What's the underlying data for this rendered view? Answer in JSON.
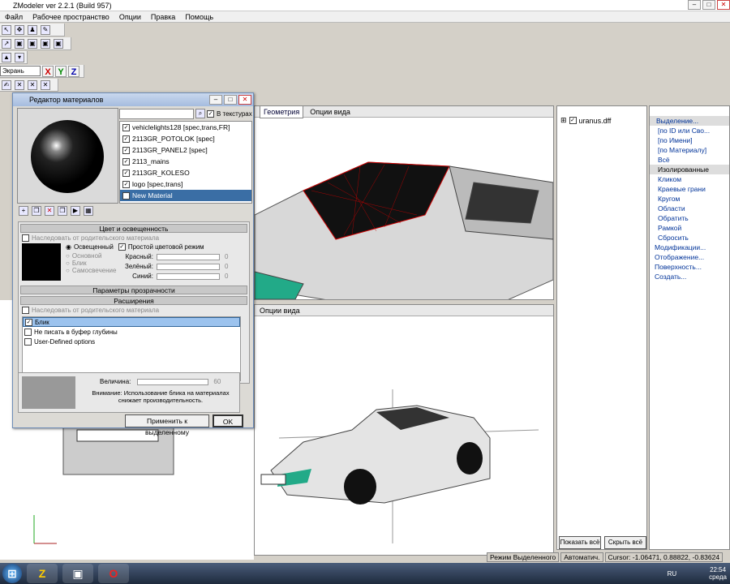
{
  "app": {
    "title": "ZModeler ver 2.2.1 (Build 957)"
  },
  "menu": [
    "Файл",
    "Рабочее пространство",
    "Опции",
    "Правка",
    "Помощь"
  ],
  "toolbar": {
    "view_select": "Экрань",
    "axis_x": "X",
    "axis_y": "Y",
    "axis_z": "Z"
  },
  "viewports": {
    "top": {
      "tab": "Геометрия",
      "options": "Опции вида"
    },
    "bottom": {
      "options": "Опции вида"
    }
  },
  "dialog": {
    "title": "Редактор материалов",
    "in_textures": "В текстурах",
    "materials": [
      "vehiclelights128 [spec,trans,FR]",
      "2113GR_POTOLOK [spec]",
      "2113GR_PANEL2 [spec]",
      "2113_mains",
      "2113GR_KOLESO",
      "logo [spec,trans]",
      "New Material"
    ],
    "color_section": "Цвет и освещенность",
    "inherit_parent": "Наследовать от родительского материала",
    "lit": "Освещенный",
    "simple_color": "Простой цветовой режим",
    "basic": "Основной",
    "highlight": "Блик",
    "self_illum": "Самосвечение",
    "red": "Красный:",
    "green": "Зелёный:",
    "blue": "Синий:",
    "red_val": "0",
    "green_val": "0",
    "blue_val": "0",
    "transparency_section": "Параметры прозрачности",
    "extensions_section": "Расширения",
    "inherit_parent2": "Наследовать от родительского материала",
    "ext_items": [
      "Блик",
      "Не писать в буфер глубины",
      "User-Defined options"
    ],
    "magnitude": "Величина:",
    "magnitude_val": "60",
    "warning": "Внимание: Использование блика на материалах снижает производительность.",
    "apply": "Применить к выделенному",
    "ok": "OK"
  },
  "scene": {
    "file": "uranus.dff",
    "show_all": "Показать всё",
    "hide_all": "Скрыть всё"
  },
  "selection_panel": [
    "Выделение...",
    "[по ID или Сво...",
    "[по Имени]",
    "[по Материалу]",
    "Всё",
    "Изолированные",
    "Кликом",
    "Краевые грани",
    "Кругом",
    "Области",
    "Обратить",
    "Рамкой",
    "Сбросить",
    "Модификации...",
    "Отображение...",
    "Поверхность...",
    "Создать..."
  ],
  "status": {
    "mode": "Режим Выделенного",
    "auto": "Автоматич.",
    "cursor": "Cursor: -1.06471, 0.88822, -0.83624"
  },
  "taskbar": {
    "lang": "RU",
    "time": "22:54",
    "day": "среда"
  }
}
